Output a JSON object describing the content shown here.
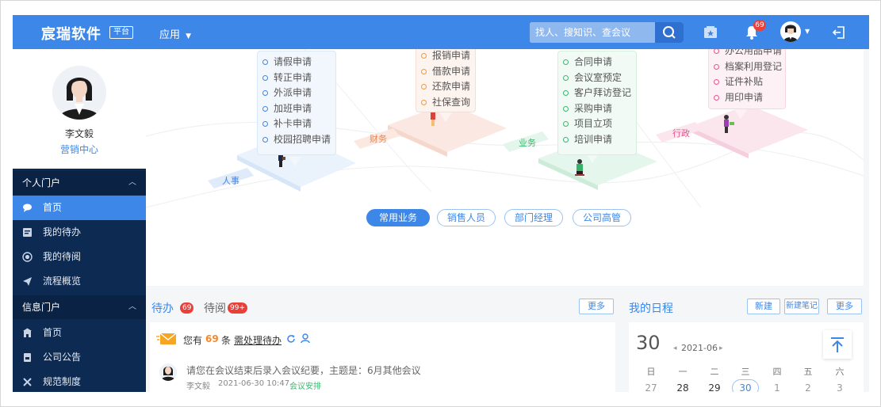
{
  "topbar": {
    "logo_text": "宸瑞软件",
    "logo_badge": "平台",
    "app_menu": "应用",
    "search_placeholder": "找人、搜知识、查会议",
    "notification_count": "69"
  },
  "profile": {
    "name": "李文毅",
    "department": "营销中心"
  },
  "sidebar": {
    "groups": [
      {
        "label": "个人门户",
        "items": [
          {
            "label": "首页"
          },
          {
            "label": "我的待办"
          },
          {
            "label": "我的待阅"
          },
          {
            "label": "流程概览"
          }
        ]
      },
      {
        "label": "信息门户",
        "items": [
          {
            "label": "首页"
          },
          {
            "label": "公司公告"
          },
          {
            "label": "规范制度"
          }
        ]
      }
    ]
  },
  "banner": {
    "hr": {
      "label": "人事",
      "items": [
        "请假申请",
        "转正申请",
        "外派申请",
        "加班申请",
        "补卡申请",
        "校园招聘申请"
      ]
    },
    "finance": {
      "label": "财务",
      "items": [
        "报销申请",
        "借款申请",
        "还款申请",
        "社保查询"
      ]
    },
    "business": {
      "label": "业务",
      "items": [
        "合同申请",
        "会议室预定",
        "客户拜访登记",
        "采购申请",
        "项目立项",
        "培训申请"
      ]
    },
    "admin": {
      "label": "行政",
      "items": [
        "办公用品申请",
        "档案利用登记",
        "证件补贴",
        "用印申请"
      ]
    },
    "tabs": [
      "常用业务",
      "销售人员",
      "部门经理",
      "公司高管"
    ]
  },
  "todo": {
    "tab_todo": "待办",
    "todo_count": "69",
    "tab_read": "待阅",
    "read_count": "99+",
    "more": "更多",
    "summary_prefix": "您有",
    "summary_count": "69",
    "summary_unit": "条",
    "summary_link": "需处理待办",
    "item": {
      "title": "请您在会议结束后录入会议纪要，主题是：6月其他会议",
      "author": "李文毅",
      "time": "2021-06-30 10:47",
      "tag": "会议安排"
    }
  },
  "schedule": {
    "title": "我的日程",
    "btn_new": "新建",
    "btn_note": "新建笔记",
    "btn_more": "更多",
    "day": "30",
    "month": "2021-06",
    "weekdays": [
      "日",
      "一",
      "二",
      "三",
      "四",
      "五",
      "六"
    ],
    "dates": [
      "27",
      "28",
      "29",
      "30",
      "1",
      "2",
      "3"
    ]
  },
  "colors": {
    "primary": "#3d87e8",
    "sidebar": "#0d2a52",
    "badge": "#e8413b",
    "todo_count": "#f5882b"
  }
}
